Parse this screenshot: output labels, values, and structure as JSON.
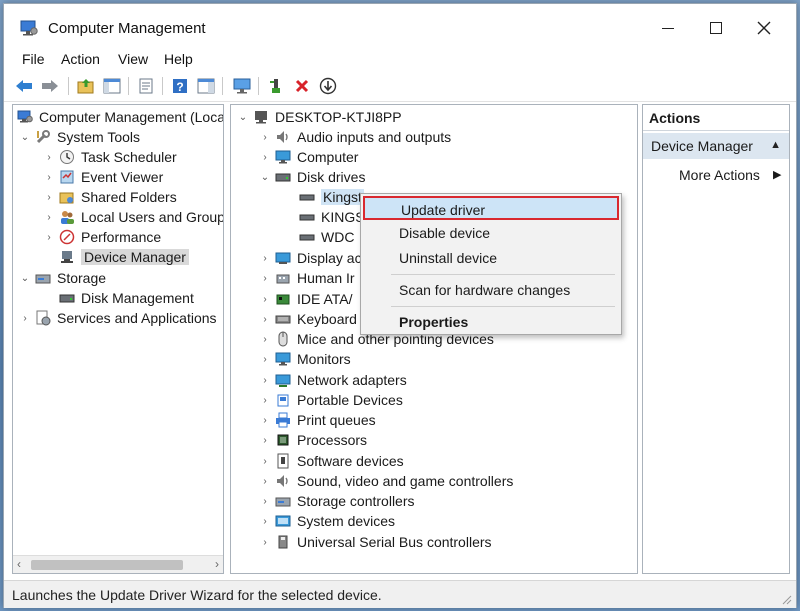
{
  "window": {
    "title": "Computer Management"
  },
  "menu": [
    "File",
    "Action",
    "View",
    "Help"
  ],
  "toolbar": [
    "back-arrow-icon",
    "forward-arrow-icon",
    "up-folder-icon",
    "show-hide-console-tree-icon",
    "properties-icon",
    "help-icon",
    "help-pane-icon",
    "monitor-icon",
    "scan-hardware-icon",
    "uninstall-x-icon",
    "update-driver-icon"
  ],
  "left_tree": {
    "root": "Computer Management (Local",
    "system_tools": "System Tools",
    "task_scheduler": "Task Scheduler",
    "event_viewer": "Event Viewer",
    "shared_folders": "Shared Folders",
    "local_users": "Local Users and Groups",
    "performance": "Performance",
    "device_manager": "Device Manager",
    "storage": "Storage",
    "disk_management": "Disk Management",
    "services": "Services and Applications"
  },
  "device_tree": {
    "root": "DESKTOP-KTJI8PP",
    "audio": "Audio inputs and outputs",
    "computer": "Computer",
    "disk_drives": "Disk drives",
    "disk1": "Kingst",
    "disk2": "KINGS",
    "disk3": "WDC",
    "display": "Display ac",
    "human": "Human Ir",
    "ide": "IDE ATA/",
    "keyboards": "Keyboard",
    "mice": "Mice and other pointing devices",
    "monitors": "Monitors",
    "network": "Network adapters",
    "portable": "Portable Devices",
    "print": "Print queues",
    "processors": "Processors",
    "software": "Software devices",
    "sound": "Sound, video and game controllers",
    "storage_ctrl": "Storage controllers",
    "system": "System devices",
    "usb": "Universal Serial Bus controllers"
  },
  "context_menu": {
    "update": "Update driver",
    "disable": "Disable device",
    "uninstall": "Uninstall device",
    "scan": "Scan for hardware changes",
    "properties": "Properties"
  },
  "actions_pane": {
    "header": "Actions",
    "section": "Device Manager",
    "more": "More Actions"
  },
  "status": "Launches the Update Driver Wizard for the selected device.",
  "colors": {
    "highlight_border": "#d9282f",
    "highlight_fill": "#cde4f7",
    "actions_section": "#dce6f0"
  }
}
